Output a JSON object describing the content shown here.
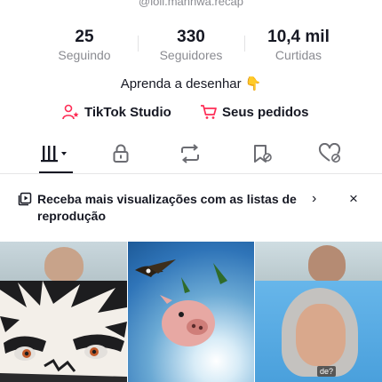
{
  "profile": {
    "handle": "@loli.manhwa.recap",
    "bio": "Aprenda a desenhar",
    "bio_emoji": "👇"
  },
  "stats": [
    {
      "value": "25",
      "label": "Seguindo"
    },
    {
      "value": "330",
      "label": "Seguidores"
    },
    {
      "value": "10,4 mil",
      "label": "Curtidas"
    }
  ],
  "links": {
    "studio": "TikTok Studio",
    "orders": "Seus pedidos"
  },
  "tabs": [
    {
      "icon": "grid-icon",
      "active": true
    },
    {
      "icon": "lock-icon",
      "active": false
    },
    {
      "icon": "repost-icon",
      "active": false
    },
    {
      "icon": "bookmark-icon",
      "active": false
    },
    {
      "icon": "liked-heart-icon",
      "active": false
    }
  ],
  "banner": {
    "text": "Receba mais visualizações com as listas de reprodução",
    "chevron": "›",
    "close": "×"
  },
  "videos": [
    {
      "subtitle": ""
    },
    {
      "subtitle": ""
    },
    {
      "subtitle": "de?"
    }
  ],
  "colors": {
    "accent": "#fe2c55",
    "text": "#161823",
    "muted": "#8a8b91"
  }
}
